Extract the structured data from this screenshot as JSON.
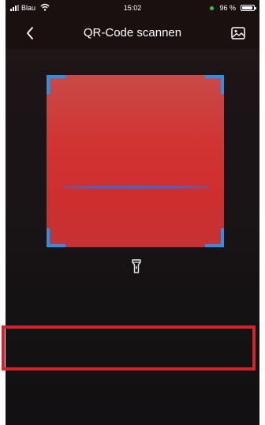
{
  "status_bar": {
    "carrier": "Blau",
    "time": "15:02",
    "battery_percent": "96 %",
    "battery_level": 0.96
  },
  "nav": {
    "title": "QR-Code scannen",
    "back_icon": "chevron-left-icon",
    "gallery_icon": "image-gallery-icon"
  },
  "scanner": {
    "flashlight_icon": "flashlight-icon"
  },
  "colors": {
    "frame_corners": "#2e8fe6",
    "scan_line": "#4b63c6",
    "highlight": "#d3222a",
    "battery_dot": "#3ac24a"
  }
}
